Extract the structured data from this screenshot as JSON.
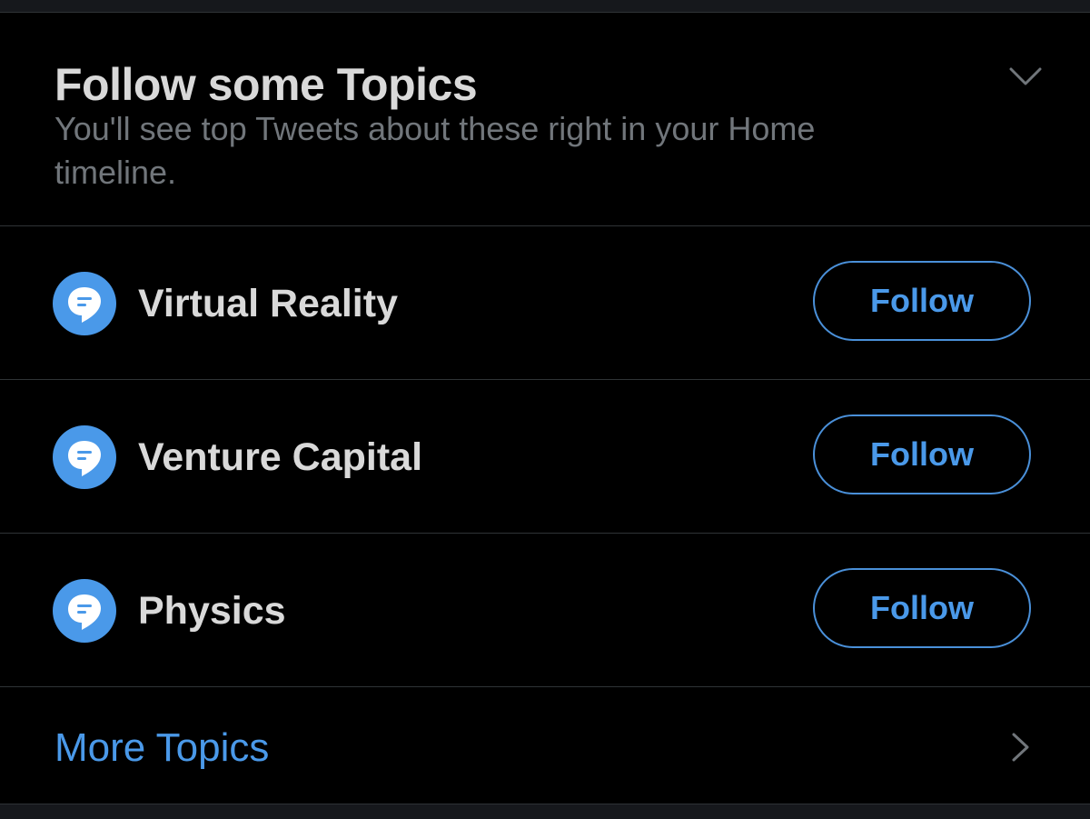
{
  "colors": {
    "background": "#000000",
    "divider": "#2f3336",
    "accent": "#4a99e9",
    "primary_text": "#d9d9d9",
    "secondary_text": "#71767b"
  },
  "header": {
    "title": "Follow some Topics",
    "subtitle": "You'll see top Tweets about these right in your Home timeline.",
    "collapse_icon": "chevron-down-icon"
  },
  "topics": [
    {
      "label": "Virtual Reality",
      "icon": "topic-bubble-icon",
      "button": "Follow"
    },
    {
      "label": "Venture Capital",
      "icon": "topic-bubble-icon",
      "button": "Follow"
    },
    {
      "label": "Physics",
      "icon": "topic-bubble-icon",
      "button": "Follow"
    }
  ],
  "more": {
    "label": "More Topics",
    "icon": "chevron-right-icon"
  }
}
